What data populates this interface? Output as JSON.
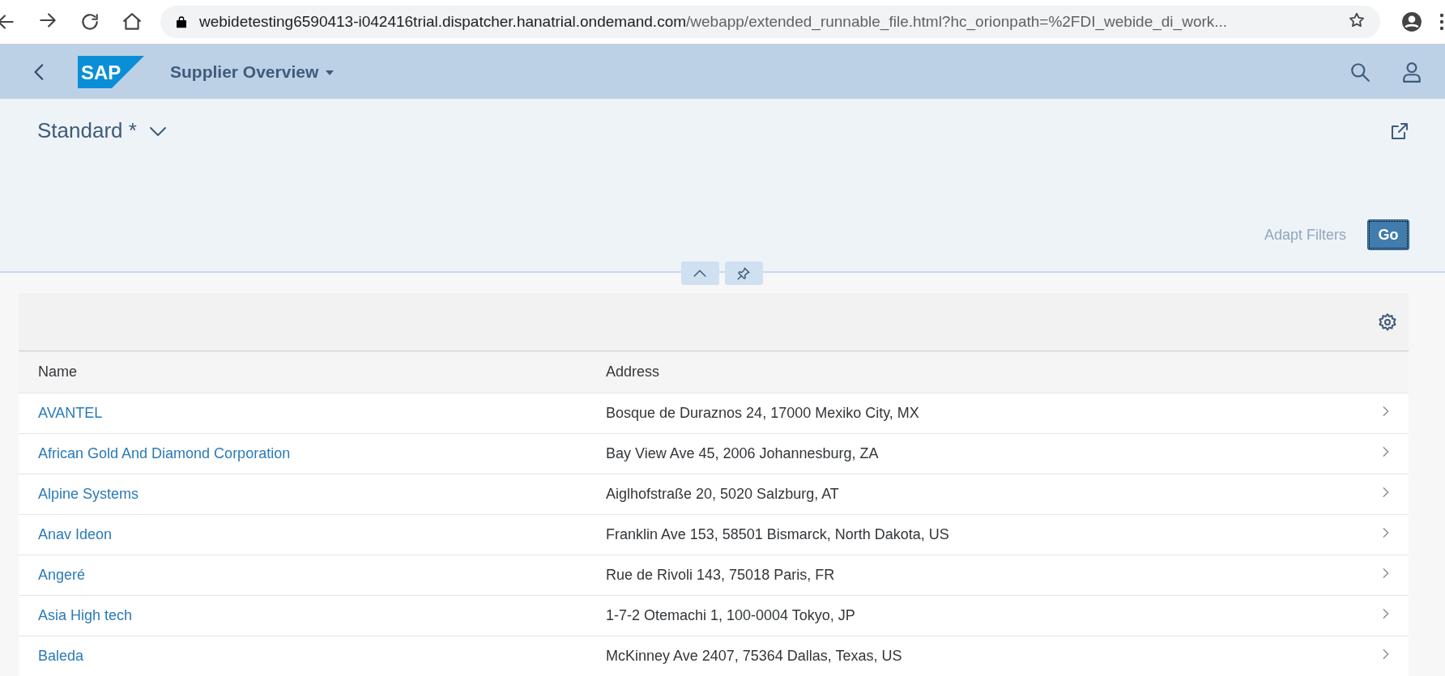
{
  "browser": {
    "url_host": "webidetesting6590413-i042416trial.dispatcher.hanatrial.ondemand.com",
    "url_path": "/webapp/extended_runnable_file.html?hc_orionpath=%2FDI_webide_di_work..."
  },
  "shell": {
    "logo": "SAP",
    "title": "Supplier Overview"
  },
  "header": {
    "variant": "Standard *",
    "adapt_filters": "Adapt Filters",
    "go": "Go"
  },
  "table": {
    "columns": [
      "Name",
      "Address"
    ],
    "rows": [
      {
        "name": "AVANTEL",
        "address": "Bosque de Duraznos 24, 17000 Mexiko City, MX"
      },
      {
        "name": "African Gold And Diamond Corporation",
        "address": "Bay View Ave 45, 2006 Johannesburg, ZA"
      },
      {
        "name": "Alpine Systems",
        "address": "Aiglhofstraße 20, 5020 Salzburg, AT"
      },
      {
        "name": "Anav Ideon",
        "address": "Franklin Ave 153, 58501 Bismarck, North Dakota, US"
      },
      {
        "name": "Angeré",
        "address": "Rue de Rivoli 143, 75018 Paris, FR"
      },
      {
        "name": "Asia High tech",
        "address": "1-7-2 Otemachi 1, 100-0004 Tokyo, JP"
      },
      {
        "name": "Baleda",
        "address": "McKinney Ave 2407, 75364 Dallas, Texas, US"
      }
    ]
  }
}
